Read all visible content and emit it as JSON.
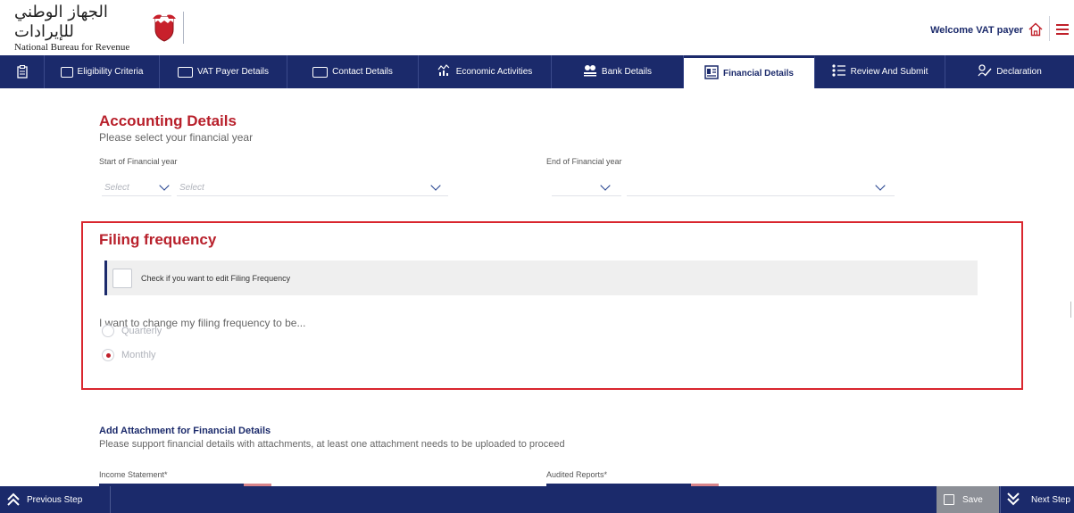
{
  "header": {
    "logo_arabic": "الجهاز الوطني للإيرادات",
    "logo_english": "National Bureau for Revenue",
    "welcome_text": "Welcome VAT payer",
    "icons": [
      "home-icon",
      "menu-icon"
    ]
  },
  "nav": {
    "items": [
      {
        "label": "Eligibility Criteria",
        "icon": "checklist-icon"
      },
      {
        "label": "VAT Payer Details",
        "icon": "id-card-icon"
      },
      {
        "label": "Contact Details",
        "icon": "contact-card-icon"
      },
      {
        "label": "Economic Activities",
        "icon": "activity-chart-icon"
      },
      {
        "label": "Bank Details",
        "icon": "bank-icon"
      },
      {
        "label": "Financial Details",
        "icon": "financial-doc-icon",
        "active": true
      },
      {
        "label": "Review And Submit",
        "icon": "list-icon"
      },
      {
        "label": "Declaration",
        "icon": "signature-icon"
      }
    ]
  },
  "accounting": {
    "title": "Accounting Details",
    "subtitle": "Please select your financial year",
    "start_label": "Start of Financial year",
    "end_label": "End of Financial year",
    "start_month_placeholder": "Select",
    "start_year_placeholder": "Select"
  },
  "filing": {
    "title": "Filing frequency",
    "checkbox_label": "Check if you want to edit Filing Frequency",
    "change_label": "I want to change my filing frequency to be...",
    "options": [
      {
        "label": "Quarterly",
        "selected": false
      },
      {
        "label": "Monthly",
        "selected": true
      }
    ]
  },
  "attachments": {
    "title": "Add Attachment for Financial Details",
    "subtitle": "Please support financial details with attachments, at least one attachment needs to be uploaded to proceed",
    "income_label": "Income Statement*",
    "audited_label": "Audited Reports*"
  },
  "footer": {
    "previous_label": "Previous Step",
    "save_label": "Save",
    "next_label": "Next Step"
  },
  "colors": {
    "navy": "#1b2a6b",
    "brand_red": "#b8202b",
    "highlight_border": "#d9262e"
  }
}
